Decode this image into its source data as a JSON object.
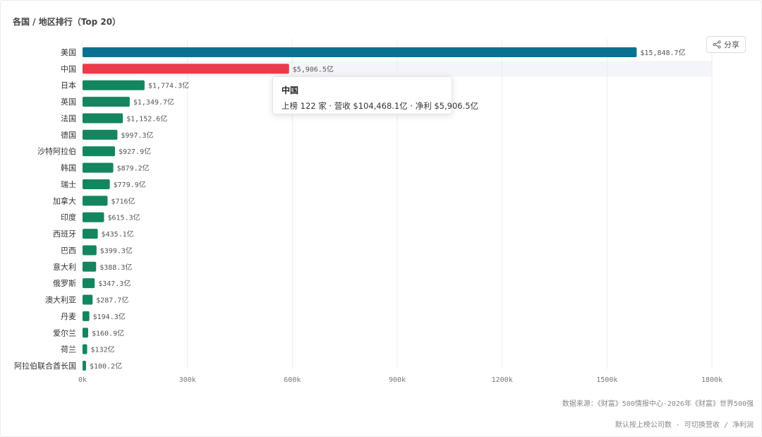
{
  "header": {
    "title": "各国 / 地区排行（Top 20）"
  },
  "toolbar": {
    "share_label": "分享",
    "share_icon": "share-icon"
  },
  "tooltip": {
    "title": "中国",
    "body": "上榜 122 家 · 营收 $104,468.1亿 · 净利 $5,906.5亿"
  },
  "footer": {
    "source": "数据来源：《财富》500情报中心·2026年《财富》世界500强",
    "hint": "默认按上榜公司数 · 可切换营收 / 净利润"
  },
  "colors": {
    "highlight": "#0b7191",
    "hover": "#ea3b4b",
    "default": "#14865f"
  },
  "chart_data": {
    "type": "bar",
    "orientation": "horizontal",
    "categories": [
      "美国",
      "中国",
      "日本",
      "英国",
      "法国",
      "德国",
      "沙特阿拉伯",
      "韩国",
      "瑞士",
      "加拿大",
      "印度",
      "西班牙",
      "巴西",
      "意大利",
      "俄罗斯",
      "澳大利亚",
      "丹麦",
      "爱尔兰",
      "荷兰",
      "阿拉伯联合酋长国"
    ],
    "values": [
      15848.7,
      5906.5,
      1774.3,
      1349.7,
      1152.6,
      997.3,
      927.9,
      879.2,
      779.9,
      716,
      615.3,
      435.1,
      399.3,
      388.3,
      347.3,
      287.7,
      194.3,
      160.9,
      132,
      100.2
    ],
    "value_labels": [
      "$15,848.7亿",
      "$5,906.5亿",
      "$1,774.3亿",
      "$1,349.7亿",
      "$1,152.6亿",
      "$997.3亿",
      "$927.9亿",
      "$879.2亿",
      "$779.9亿",
      "$716亿",
      "$615.3亿",
      "$435.1亿",
      "$399.3亿",
      "$388.3亿",
      "$347.3亿",
      "$287.7亿",
      "$194.3亿",
      "$160.9亿",
      "$132亿",
      "$100.2亿"
    ],
    "x_ticks": [
      0,
      3000,
      6000,
      9000,
      12000,
      15000,
      18000
    ],
    "x_tick_labels": [
      "0k",
      "300k",
      "600k",
      "900k",
      "1200k",
      "1500k",
      "1800k"
    ],
    "xlim": [
      0,
      18000
    ],
    "grid": true,
    "highlight_index": 0,
    "hover_index": 1
  }
}
